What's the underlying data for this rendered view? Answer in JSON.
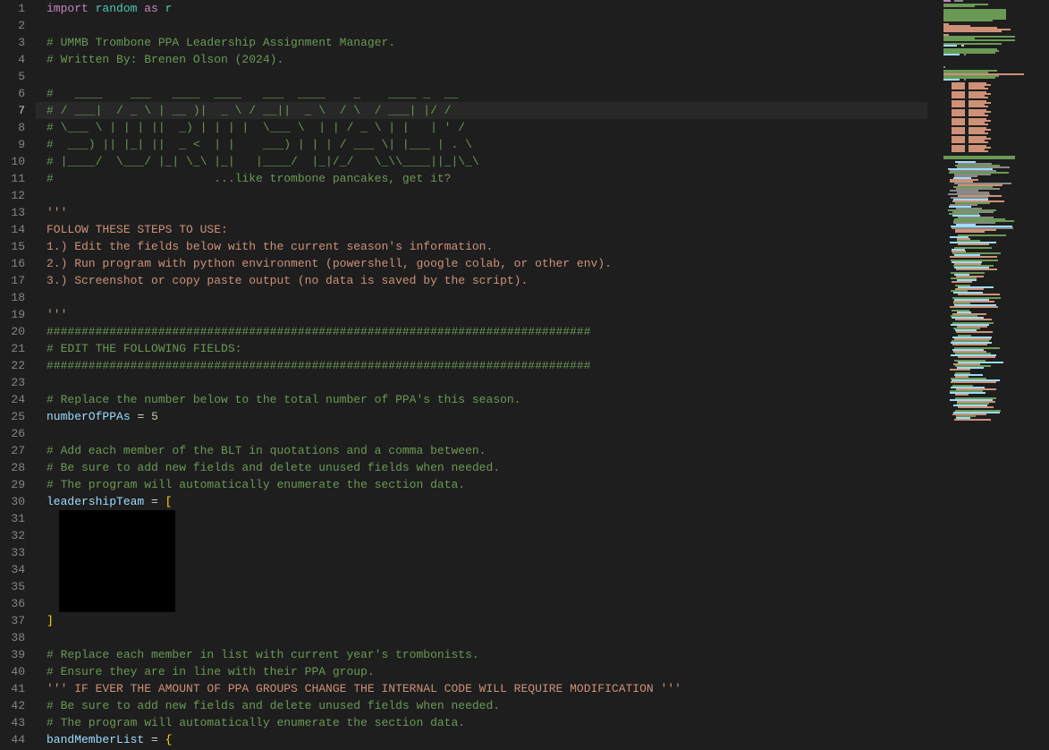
{
  "highlightedLine": 7,
  "lines": [
    {
      "num": 1,
      "tokens": [
        {
          "cls": "tk-keyword",
          "text": "import"
        },
        {
          "cls": "tk-plain",
          "text": " "
        },
        {
          "cls": "tk-module",
          "text": "random"
        },
        {
          "cls": "tk-plain",
          "text": " "
        },
        {
          "cls": "tk-keyword",
          "text": "as"
        },
        {
          "cls": "tk-plain",
          "text": " "
        },
        {
          "cls": "tk-module",
          "text": "r"
        }
      ]
    },
    {
      "num": 2,
      "tokens": []
    },
    {
      "num": 3,
      "tokens": [
        {
          "cls": "tk-comment",
          "text": "# UMMB Trombone PPA Leadership Assignment Manager."
        }
      ]
    },
    {
      "num": 4,
      "tokens": [
        {
          "cls": "tk-comment",
          "text": "# Written By: Brenen Olson (2024)."
        }
      ]
    },
    {
      "num": 5,
      "tokens": []
    },
    {
      "num": 6,
      "tokens": [
        {
          "cls": "tk-comment",
          "text": "#   ____    ___   ____  ____   ___  ____    _    ____ _  __"
        }
      ]
    },
    {
      "num": 7,
      "tokens": [
        {
          "cls": "tk-comment",
          "text": "# / ___|  / _ \\ | __ )|  _ \\ / __||  _ \\  / \\  / ___| |/ /"
        }
      ]
    },
    {
      "num": 8,
      "tokens": [
        {
          "cls": "tk-comment",
          "text": "# \\___ \\ | | | ||  _) | | | |  \\___ \\  | | / _ \\ | |   | ' /"
        }
      ]
    },
    {
      "num": 9,
      "tokens": [
        {
          "cls": "tk-comment",
          "text": "#  ___) || |_| ||  _ <  | |    ___) | | | / ___ \\| |___ | . \\"
        }
      ]
    },
    {
      "num": 10,
      "tokens": [
        {
          "cls": "tk-comment",
          "text": "# |____/  \\___/ |_| \\_\\ |_|   |____/  |_|/_/   \\_\\\\____||_|\\_\\"
        }
      ]
    },
    {
      "num": 11,
      "tokens": [
        {
          "cls": "tk-comment",
          "text": "#                       ...like trombone pancakes, get it?"
        }
      ]
    },
    {
      "num": 12,
      "tokens": []
    },
    {
      "num": 13,
      "tokens": [
        {
          "cls": "tk-string",
          "text": "'''"
        }
      ]
    },
    {
      "num": 14,
      "tokens": [
        {
          "cls": "tk-string",
          "text": "FOLLOW THESE STEPS TO USE:"
        }
      ]
    },
    {
      "num": 15,
      "tokens": [
        {
          "cls": "tk-string",
          "text": "1.) Edit the fields below with the current season's information."
        }
      ]
    },
    {
      "num": 16,
      "tokens": [
        {
          "cls": "tk-string",
          "text": "2.) Run program with python environment (powershell, google colab, or other env)."
        }
      ]
    },
    {
      "num": 17,
      "tokens": [
        {
          "cls": "tk-string",
          "text": "3.) Screenshot or copy paste output (no data is saved by the script)."
        }
      ]
    },
    {
      "num": 18,
      "tokens": []
    },
    {
      "num": 19,
      "tokens": [
        {
          "cls": "tk-string",
          "text": "'''"
        }
      ]
    },
    {
      "num": 20,
      "tokens": [
        {
          "cls": "tk-comment",
          "text": "##############################################################################"
        }
      ]
    },
    {
      "num": 21,
      "tokens": [
        {
          "cls": "tk-comment",
          "text": "# EDIT THE FOLLOWING FIELDS:"
        }
      ]
    },
    {
      "num": 22,
      "tokens": [
        {
          "cls": "tk-comment",
          "text": "##############################################################################"
        }
      ]
    },
    {
      "num": 23,
      "tokens": []
    },
    {
      "num": 24,
      "tokens": [
        {
          "cls": "tk-comment",
          "text": "# Replace the number below to the total number of PPA's this season."
        }
      ]
    },
    {
      "num": 25,
      "tokens": [
        {
          "cls": "tk-variable",
          "text": "numberOfPPAs"
        },
        {
          "cls": "tk-plain",
          "text": " "
        },
        {
          "cls": "tk-operator",
          "text": "="
        },
        {
          "cls": "tk-plain",
          "text": " "
        },
        {
          "cls": "tk-number",
          "text": "5"
        }
      ]
    },
    {
      "num": 26,
      "tokens": []
    },
    {
      "num": 27,
      "tokens": [
        {
          "cls": "tk-comment",
          "text": "# Add each member of the BLT in quotations and a comma between."
        }
      ]
    },
    {
      "num": 28,
      "tokens": [
        {
          "cls": "tk-comment",
          "text": "# Be sure to add new fields and delete unused fields when needed."
        }
      ]
    },
    {
      "num": 29,
      "tokens": [
        {
          "cls": "tk-comment",
          "text": "# The program will automatically enumerate the section data."
        }
      ]
    },
    {
      "num": 30,
      "tokens": [
        {
          "cls": "tk-variable",
          "text": "leadershipTeam"
        },
        {
          "cls": "tk-plain",
          "text": " "
        },
        {
          "cls": "tk-operator",
          "text": "="
        },
        {
          "cls": "tk-plain",
          "text": " "
        },
        {
          "cls": "tk-bracket-yellow",
          "text": "["
        }
      ]
    },
    {
      "num": 31,
      "redacted": true,
      "tokens": []
    },
    {
      "num": 32,
      "tokens": []
    },
    {
      "num": 33,
      "tokens": []
    },
    {
      "num": 34,
      "tokens": []
    },
    {
      "num": 35,
      "tokens": []
    },
    {
      "num": 36,
      "tokens": []
    },
    {
      "num": 37,
      "tokens": [
        {
          "cls": "tk-bracket-yellow",
          "text": "]"
        }
      ]
    },
    {
      "num": 38,
      "tokens": []
    },
    {
      "num": 39,
      "tokens": [
        {
          "cls": "tk-comment",
          "text": "# Replace each member in list with current year's trombonists."
        }
      ]
    },
    {
      "num": 40,
      "tokens": [
        {
          "cls": "tk-comment",
          "text": "# Ensure they are in line with their PPA group."
        }
      ]
    },
    {
      "num": 41,
      "tokens": [
        {
          "cls": "tk-string",
          "text": "''' IF EVER THE AMOUNT OF PPA GROUPS CHANGE THE INTERNAL CODE WILL REQUIRE MODIFICATION '''"
        }
      ]
    },
    {
      "num": 42,
      "tokens": [
        {
          "cls": "tk-comment",
          "text": "# Be sure to add new fields and delete unused fields when needed."
        }
      ]
    },
    {
      "num": 43,
      "tokens": [
        {
          "cls": "tk-comment",
          "text": "# The program will automatically enumerate the section data."
        }
      ]
    },
    {
      "num": 44,
      "tokens": [
        {
          "cls": "tk-variable",
          "text": "bandMemberList"
        },
        {
          "cls": "tk-plain",
          "text": " "
        },
        {
          "cls": "tk-operator",
          "text": "="
        },
        {
          "cls": "tk-plain",
          "text": " "
        },
        {
          "cls": "tk-bracket-yellow",
          "text": "{"
        }
      ]
    }
  ],
  "minimapColors": {
    "comment": "#6a9955",
    "string": "#ce9178",
    "keyword": "#c586c0",
    "variable": "#9cdcfe",
    "number": "#b5cea8",
    "plain": "#888888"
  }
}
